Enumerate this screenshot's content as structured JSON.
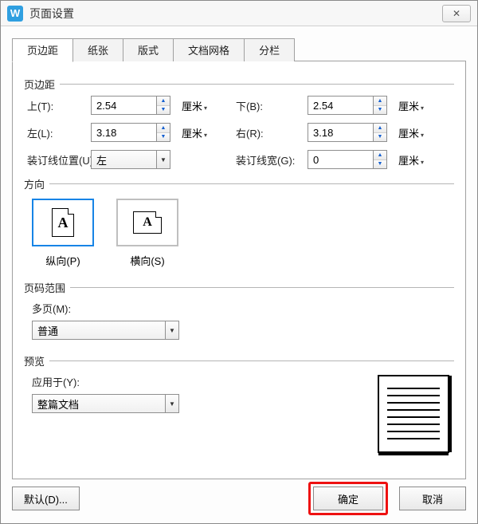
{
  "window": {
    "title": "页面设置",
    "icon_letter": "W"
  },
  "tabs": {
    "items": [
      {
        "label": "页边距",
        "active": true
      },
      {
        "label": "纸张",
        "active": false
      },
      {
        "label": "版式",
        "active": false
      },
      {
        "label": "文档网格",
        "active": false
      },
      {
        "label": "分栏",
        "active": false
      }
    ]
  },
  "group_margins": {
    "title": "页边距",
    "top": {
      "label": "上(T):",
      "value": "2.54",
      "unit": "厘米"
    },
    "bottom": {
      "label": "下(B):",
      "value": "2.54",
      "unit": "厘米"
    },
    "left": {
      "label": "左(L):",
      "value": "3.18",
      "unit": "厘米"
    },
    "right": {
      "label": "右(R):",
      "value": "3.18",
      "unit": "厘米"
    },
    "gutter_pos": {
      "label": "装订线位置(U):",
      "value": "左"
    },
    "gutter_size": {
      "label": "装订线宽(G):",
      "value": "0",
      "unit": "厘米"
    }
  },
  "group_orientation": {
    "title": "方向",
    "portrait": {
      "label": "纵向(P)",
      "selected": true
    },
    "landscape": {
      "label": "横向(S)",
      "selected": false
    }
  },
  "group_range": {
    "title": "页码范围",
    "multi": {
      "label": "多页(M):",
      "value": "普通"
    }
  },
  "group_preview": {
    "title": "预览",
    "apply_to": {
      "label": "应用于(Y):",
      "value": "整篇文档"
    }
  },
  "buttons": {
    "default": "默认(D)...",
    "ok": "确定",
    "cancel": "取消"
  }
}
